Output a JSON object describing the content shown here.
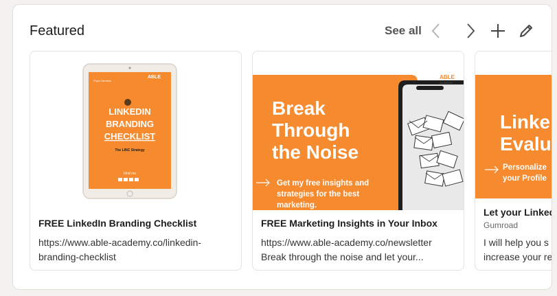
{
  "section": {
    "title": "Featured",
    "see_all_label": "See all"
  },
  "icons": {
    "prev": "chevron-left-icon",
    "next": "chevron-right-icon",
    "add": "plus-icon",
    "edit": "pencil-icon"
  },
  "colors": {
    "accent": "#f68a2e",
    "text": "#1d1d1d"
  },
  "cards": [
    {
      "title": "FREE LinkedIn Branding Checklist",
      "desc_line1": "https://www.able-academy.co/linkedin-",
      "desc_line2": "branding-checklist",
      "thumb": {
        "logo_top": "ABLE",
        "logo_sub": "ACADEMY",
        "name": "Priya Careless",
        "heading1": "LINKEDIN",
        "heading2": "BRANDING",
        "heading3": "CHECKLIST",
        "subheading": "The LINC Strategy",
        "find_me": "Find me"
      }
    },
    {
      "title": "FREE Marketing Insights in Your Inbox",
      "desc_line1": "https://www.able-academy.co/newsletter",
      "desc_line2": "Break through the noise and let your...",
      "thumb": {
        "logo_top": "ABLE",
        "logo_sub": "ACADEMY",
        "headline1": "Break",
        "headline2": "Through",
        "headline3": "the Noise",
        "body1": "Get my free insights and",
        "body2": "strategies for the best",
        "body3": "marketing."
      }
    },
    {
      "title": "Let your Linked",
      "subtitle": "Gumroad",
      "desc_line1": "I will help you s",
      "desc_line2": "increase your re",
      "thumb": {
        "headline1": "Linke",
        "headline2": "Evalu",
        "body1": "Personalize",
        "body2": "your Profile"
      }
    }
  ]
}
